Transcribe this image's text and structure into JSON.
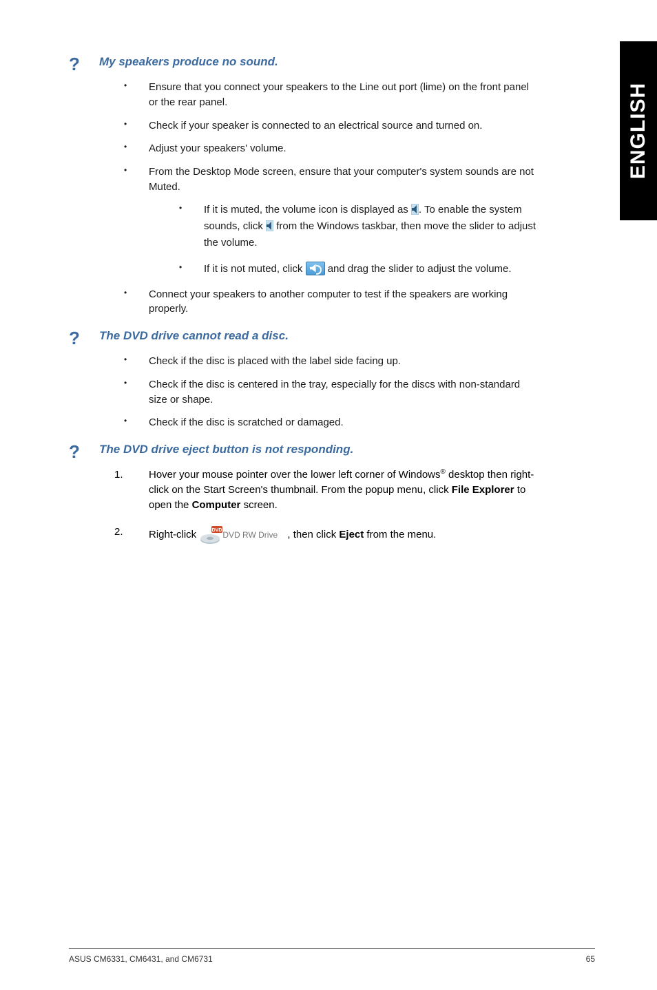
{
  "sidebar": {
    "label": "ENGLISH"
  },
  "sections": {
    "s1": {
      "title": "My speakers produce no sound.",
      "b1": "Ensure that you connect your speakers to the Line out port (lime) on the front panel or the rear panel.",
      "b2": "Check if your speaker is connected to an electrical source and turned on.",
      "b3": "Adjust your speakers' volume.",
      "b4": "From the Desktop Mode screen, ensure that your computer's system sounds are not Muted.",
      "b4s1a": "If it is muted, the volume icon is displayed as ",
      "b4s1b": ". To enable the system sounds, click ",
      "b4s1c": " from the Windows taskbar, then move the slider to adjust the volume.",
      "b4s2a": "If it is not muted, click ",
      "b4s2b": " and drag the slider to adjust the volume.",
      "b5": "Connect your speakers to another computer to test if the speakers are working properly."
    },
    "s2": {
      "title": "The DVD drive cannot read a disc.",
      "b1": "Check if the disc is placed with the label side facing up.",
      "b2": "Check if the disc is centered in the tray, especially for the discs with non-standard size or shape.",
      "b3": "Check if the disc is scratched or damaged."
    },
    "s3": {
      "title": "The DVD drive eject button is not responding.",
      "n1a": "Hover your mouse pointer over the lower left corner of Windows",
      "n1b": " desktop then right-click on the Start Screen's thumbnail. From the popup menu, click ",
      "n1c": "File Explorer",
      "n1d": " to open the ",
      "n1e": "Computer",
      "n1f": " screen.",
      "n2a": "Right-click ",
      "n2b": ", then click ",
      "n2c": "Eject",
      "n2d": " from the menu.",
      "driveLabel": "DVD RW Drive"
    }
  },
  "footer": {
    "left": "ASUS CM6331, CM6431, and CM6731",
    "right": "65"
  },
  "numbers": {
    "one": "1.",
    "two": "2."
  }
}
